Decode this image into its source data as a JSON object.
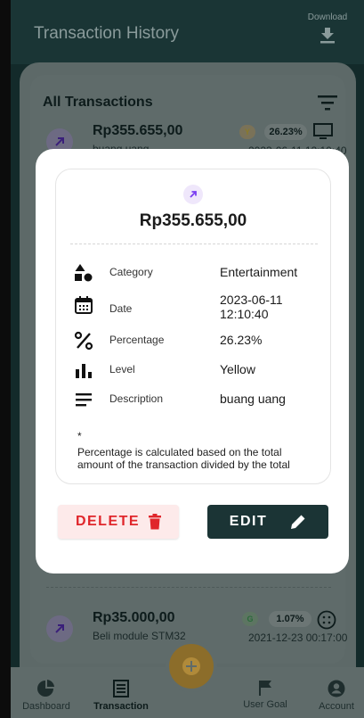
{
  "header": {
    "title": "Transaction History",
    "download_label": "Download"
  },
  "list": {
    "title": "All Transactions",
    "transactions": [
      {
        "amount": "Rp355.655,00",
        "description": "buang uang",
        "level_letter": "Y",
        "percentage": "26.23%",
        "date": "2023-06-11 12:10:40"
      },
      {
        "amount": "Rp35.000,00",
        "description": "Beli module STM32",
        "level_letter": "G",
        "percentage": "1.07%",
        "date": "2021-12-23 00:17:00"
      }
    ]
  },
  "modal": {
    "amount": "Rp355.655,00",
    "rows": [
      {
        "label": "Category",
        "value": "Entertainment",
        "icon": "shapes-icon"
      },
      {
        "label": "Date",
        "value": "2023-06-11\n12:10:40",
        "icon": "calendar-icon"
      },
      {
        "label": "Percentage",
        "value": "26.23%",
        "icon": "percent-icon"
      },
      {
        "label": "Level",
        "value": "Yellow",
        "icon": "bar-chart-icon"
      },
      {
        "label": "Description",
        "value": "buang uang",
        "icon": "notes-icon"
      }
    ],
    "note_star": "*",
    "note": "Percentage is calculated based on the total amount of the transaction divided by the total",
    "delete_label": "DELETE",
    "edit_label": "EDIT"
  },
  "nav": {
    "items": [
      {
        "label": "Dashboard",
        "icon": "pie-chart-icon"
      },
      {
        "label": "Transaction",
        "icon": "list-icon"
      },
      {
        "label": "User Goal",
        "icon": "flag-icon"
      },
      {
        "label": "Account",
        "icon": "account-icon"
      }
    ]
  },
  "colors": {
    "accent_dark": "#1b3435",
    "delete_red": "#e0262b",
    "fab_gold": "#e8b43c",
    "icon_purple": "#7b3ff2"
  }
}
